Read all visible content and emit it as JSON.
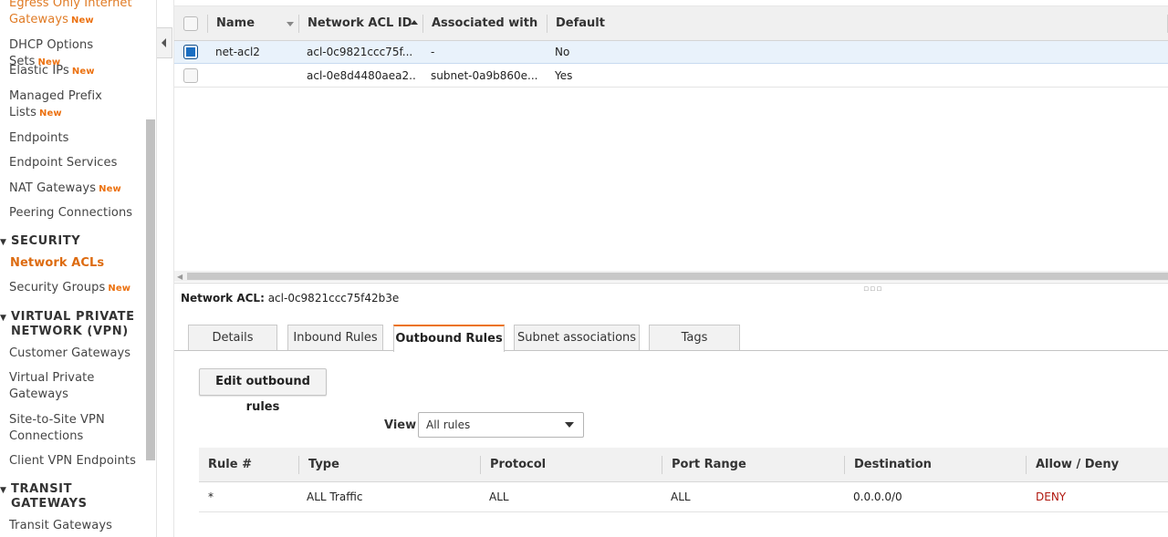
{
  "sidebar": {
    "items": [
      {
        "label": "Egress Only Internet Gateways",
        "badge": "New"
      },
      {
        "label": "DHCP Options Sets",
        "badge": "New"
      },
      {
        "label": "Elastic IPs",
        "badge": "New"
      },
      {
        "label": "Managed Prefix Lists",
        "badge": "New"
      },
      {
        "label": "Endpoints",
        "badge": ""
      },
      {
        "label": "Endpoint Services",
        "badge": ""
      },
      {
        "label": "NAT Gateways",
        "badge": "New"
      },
      {
        "label": "Peering Connections",
        "badge": ""
      }
    ],
    "security": {
      "heading": "SECURITY",
      "items": [
        {
          "label": "Network ACLs",
          "badge": ""
        },
        {
          "label": "Security Groups",
          "badge": "New"
        }
      ]
    },
    "vpn": {
      "heading_line1": "VIRTUAL PRIVATE",
      "heading_line2": "NETWORK (VPN)",
      "items": [
        {
          "label": "Customer Gateways"
        },
        {
          "label": "Virtual Private Gateways"
        },
        {
          "label": "Site-to-Site VPN Connections"
        },
        {
          "label": "Client VPN Endpoints"
        }
      ]
    },
    "transit": {
      "heading_line1": "TRANSIT",
      "heading_line2": "GATEWAYS",
      "items": [
        {
          "label": "Transit Gateways"
        }
      ]
    }
  },
  "acl_table": {
    "columns": [
      "Name",
      "Network ACL ID",
      "Associated with",
      "Default"
    ],
    "rows": [
      {
        "name": "net-acl2",
        "id": "acl-0c9821ccc75f...",
        "associated": "-",
        "default": "No",
        "selected": true
      },
      {
        "name": "",
        "id": "acl-0e8d4480aea2...",
        "associated": "subnet-0a9b860e...",
        "default": "Yes",
        "selected": false
      }
    ]
  },
  "detail": {
    "label": "Network ACL:",
    "value": "acl-0c9821ccc75f42b3e"
  },
  "tabs": [
    {
      "label": "Details",
      "active": false
    },
    {
      "label": "Inbound Rules",
      "active": false
    },
    {
      "label": "Outbound Rules",
      "active": true
    },
    {
      "label": "Subnet associations",
      "active": false
    },
    {
      "label": "Tags",
      "active": false
    }
  ],
  "outbound": {
    "edit_button": "Edit outbound rules",
    "view_label": "View",
    "view_value": "All rules",
    "columns": [
      "Rule #",
      "Type",
      "Protocol",
      "Port Range",
      "Destination",
      "Allow / Deny"
    ],
    "rules": [
      {
        "rule": "*",
        "type": "ALL Traffic",
        "protocol": "ALL",
        "port_range": "ALL",
        "destination": "0.0.0.0/0",
        "action": "DENY"
      }
    ]
  },
  "colors": {
    "accent": "#ec7211",
    "selected_row": "#e9f2fb",
    "deny": "#b0160d"
  }
}
